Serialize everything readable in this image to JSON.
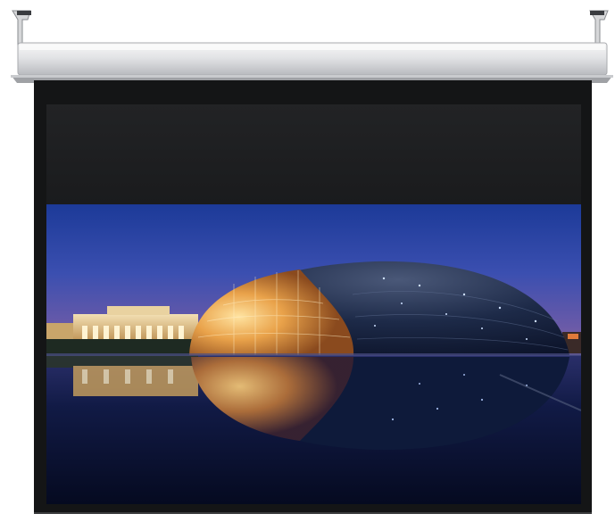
{
  "scene": {
    "subject": "motorized-projection-screen",
    "image_content": "illuminated-opera-house-dome-reflected-in-water-at-dusk"
  },
  "colors": {
    "background": "#ffffff",
    "housing": "#e9eaeb",
    "screen_border": "#151617",
    "black_drop": "#1c1d1f",
    "sky_top": "#1e3e9c",
    "sky_bottom": "#6f5fae",
    "dome_glow": "#f0b25a",
    "dome_dark": "#1a2540",
    "water": "#0b1430"
  }
}
